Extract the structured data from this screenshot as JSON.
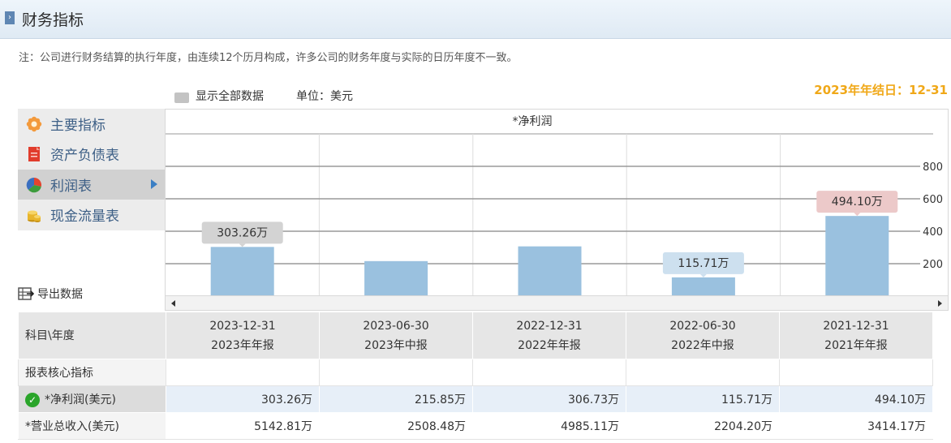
{
  "header": {
    "title": "财务指标"
  },
  "note": "注：公司进行财务结算的执行年度，由连续12个历月构成，许多公司的财务年度与实际的日历年度不一致。",
  "toolbar": {
    "show_all": "显示全部数据",
    "unit": "单位：美元",
    "year_end": "2023年年结日：12-31"
  },
  "sidebar": {
    "items": [
      {
        "label": "主要指标",
        "icon": "gear-flower-icon"
      },
      {
        "label": "资产负债表",
        "icon": "document-icon"
      },
      {
        "label": "利润表",
        "icon": "pie-chart-icon",
        "active": true
      },
      {
        "label": "现金流量表",
        "icon": "coins-icon"
      }
    ]
  },
  "export_label": "导出数据",
  "chart_data": {
    "type": "bar",
    "title": "*净利润",
    "categories": [
      "2023-12-31",
      "2023-06-30",
      "2022-12-31",
      "2022-06-30",
      "2021-12-31"
    ],
    "values": [
      303.26,
      215.85,
      306.73,
      115.71,
      494.1
    ],
    "value_labels": [
      "303.26万",
      "",
      "",
      "115.71万",
      "494.10万"
    ],
    "yticks": [
      "200",
      "400",
      "600",
      "800"
    ],
    "ylim": [
      0,
      1000
    ],
    "label_colors": [
      "#d3d3d3",
      "",
      "",
      "#cde0ef",
      "#ecc9c9"
    ],
    "bar_color": "#9ac1df"
  },
  "table": {
    "corner": "科目\\年度",
    "periods": [
      {
        "date": "2023-12-31",
        "type": "2023年年报"
      },
      {
        "date": "2023-06-30",
        "type": "2023年中报"
      },
      {
        "date": "2022-12-31",
        "type": "2022年年报"
      },
      {
        "date": "2022-06-30",
        "type": "2022年中报"
      },
      {
        "date": "2021-12-31",
        "type": "2021年年报"
      }
    ],
    "section": "报表核心指标",
    "rows": [
      {
        "label": "*净利润(美元)",
        "values": [
          "303.26万",
          "215.85万",
          "306.73万",
          "115.71万",
          "494.10万"
        ]
      },
      {
        "label": "*营业总收入(美元)",
        "values": [
          "5142.81万",
          "2508.48万",
          "4985.11万",
          "2204.20万",
          "3414.17万"
        ]
      }
    ]
  }
}
